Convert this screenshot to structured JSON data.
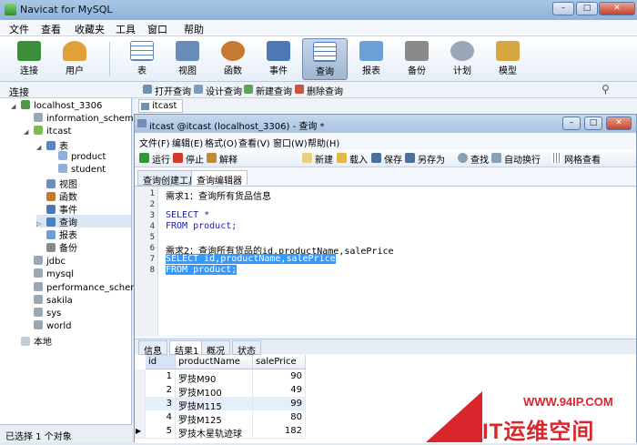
{
  "app": {
    "title": "Navicat for MySQL"
  },
  "window_controls": {
    "minimize": "–",
    "maximize": "□",
    "close": "✕"
  },
  "menu": [
    "文件",
    "查看",
    "收藏夹",
    "工具",
    "窗口",
    "帮助"
  ],
  "toolbar": [
    {
      "label": "连接",
      "icon": "connection-icon",
      "color": "#3c8f3a"
    },
    {
      "label": "用户",
      "icon": "user-icon",
      "color": "#e0a13a"
    },
    {
      "label": "表",
      "icon": "table-icon",
      "color": "#5a86c6"
    },
    {
      "label": "视图",
      "icon": "view-icon",
      "color": "#6a8cba"
    },
    {
      "label": "函数",
      "icon": "function-icon",
      "color": "#c77a2f"
    },
    {
      "label": "事件",
      "icon": "event-icon",
      "color": "#4c79b3"
    },
    {
      "label": "查询",
      "icon": "query-icon",
      "color": "#4a7fc0"
    },
    {
      "label": "报表",
      "icon": "report-icon",
      "color": "#6da0d6"
    },
    {
      "label": "备份",
      "icon": "backup-icon",
      "color": "#8a8a8a"
    },
    {
      "label": "计划",
      "icon": "schedule-icon",
      "color": "#9aa7b8"
    },
    {
      "label": "模型",
      "icon": "model-icon",
      "color": "#d7a640"
    }
  ],
  "row2": {
    "label": "连接",
    "actions": [
      "打开查询",
      "设计查询",
      "新建查询",
      "删除查询"
    ]
  },
  "tree": {
    "items": [
      "localhost_3306",
      "information_schema",
      "itcast",
      "表",
      "product",
      "student",
      "视图",
      "函数",
      "事件",
      "查询",
      "报表",
      "备份",
      "jdbc",
      "mysql",
      "performance_schema",
      "sakila",
      "sys",
      "world",
      "本地"
    ]
  },
  "status": "已选择 1 个对象",
  "object_tab": "itcast",
  "inner": {
    "title": "itcast @itcast (localhost_3306) - 查询 *",
    "menu": [
      "文件(F)",
      "编辑(E)",
      "格式(O)",
      "查看(V)",
      "窗口(W)",
      "帮助(H)"
    ],
    "toolbar": [
      "运行",
      "停止",
      "解释",
      "新建",
      "载入",
      "保存",
      "另存为",
      "查找",
      "自动换行",
      "网格查看"
    ],
    "query_tabs": [
      "查询创建工具",
      "查询编辑器"
    ],
    "result_tabs": [
      "信息",
      "结果1",
      "概况",
      "状态"
    ]
  },
  "editor": {
    "line_numbers": [
      "1",
      "2",
      "3",
      "4",
      "5",
      "6",
      "7",
      "8"
    ],
    "lines": [
      "需求1：查询所有货品信息",
      "",
      "SELECT *",
      "FROM product;",
      "",
      "需求2：查询所有货品的id,productName,salePrice",
      "SELECT id,productName,salePrice",
      "FROM product;"
    ]
  },
  "grid": {
    "headers": [
      "id",
      "productName",
      "salePrice"
    ],
    "rows": [
      [
        "1",
        "罗技M90",
        "90"
      ],
      [
        "2",
        "罗技M100",
        "49"
      ],
      [
        "3",
        "罗技M115",
        "99"
      ],
      [
        "4",
        "罗技M125",
        "80"
      ],
      [
        "5",
        "罗技木星轨迹球",
        "182"
      ]
    ]
  },
  "watermark": {
    "url": "WWW.94IP.COM",
    "brand": "IT运维空间"
  }
}
